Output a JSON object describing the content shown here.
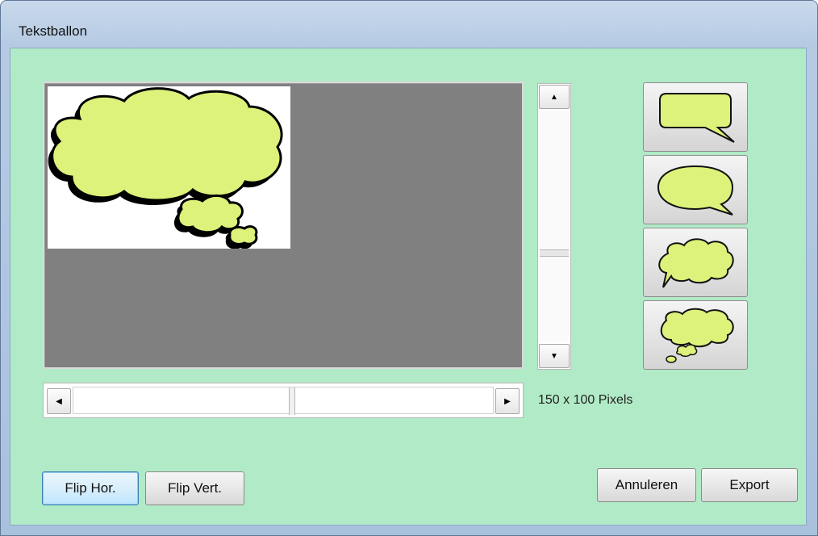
{
  "window": {
    "title": "Tekstballon"
  },
  "preview": {
    "image_icon": "thought-bubble-image"
  },
  "size_label": "150 x 100 Pixels",
  "scrollbars": {
    "up_icon": "▲",
    "down_icon": "▼",
    "left_icon": "◀",
    "right_icon": "▶"
  },
  "styles": [
    {
      "name": "rectangle-speech-bubble-icon"
    },
    {
      "name": "oval-speech-bubble-icon"
    },
    {
      "name": "cloud-speech-bubble-icon"
    },
    {
      "name": "thought-bubble-icon"
    }
  ],
  "buttons": {
    "flip_hor": "Flip Hor.",
    "flip_vert": "Flip Vert.",
    "cancel": "Annuleren",
    "export": "Export"
  },
  "colors": {
    "bubble_fill": "#dcf27a",
    "client_bg": "#b1eac6",
    "preview_bg": "#808080"
  }
}
